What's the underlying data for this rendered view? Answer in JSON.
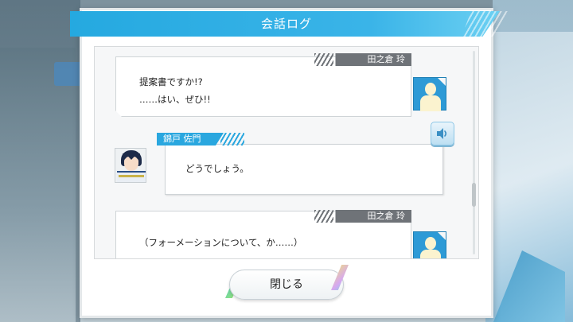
{
  "dialog": {
    "title": "会話ログ",
    "close_label": "閉じる"
  },
  "entries": [
    {
      "speaker": "田之倉 玲",
      "lines": [
        "提案書ですか!?",
        "……はい、ぜひ!!"
      ],
      "side": "right"
    },
    {
      "speaker": "錦戸 佐門",
      "lines": [
        "どうでしょう。"
      ],
      "side": "left",
      "has_voice": true
    },
    {
      "speaker": "田之倉 玲",
      "lines": [
        "（フォーメーションについて、か……）"
      ],
      "side": "right"
    }
  ],
  "colors": {
    "title_bar": "#25a9e0",
    "name_tag_self": "#6f7378",
    "name_tag_other": "#2aa7df",
    "placeholder_portrait": "#2d9ad6"
  },
  "icons": {
    "voice": "speaker-icon",
    "placeholder": "silhouette-icon"
  }
}
